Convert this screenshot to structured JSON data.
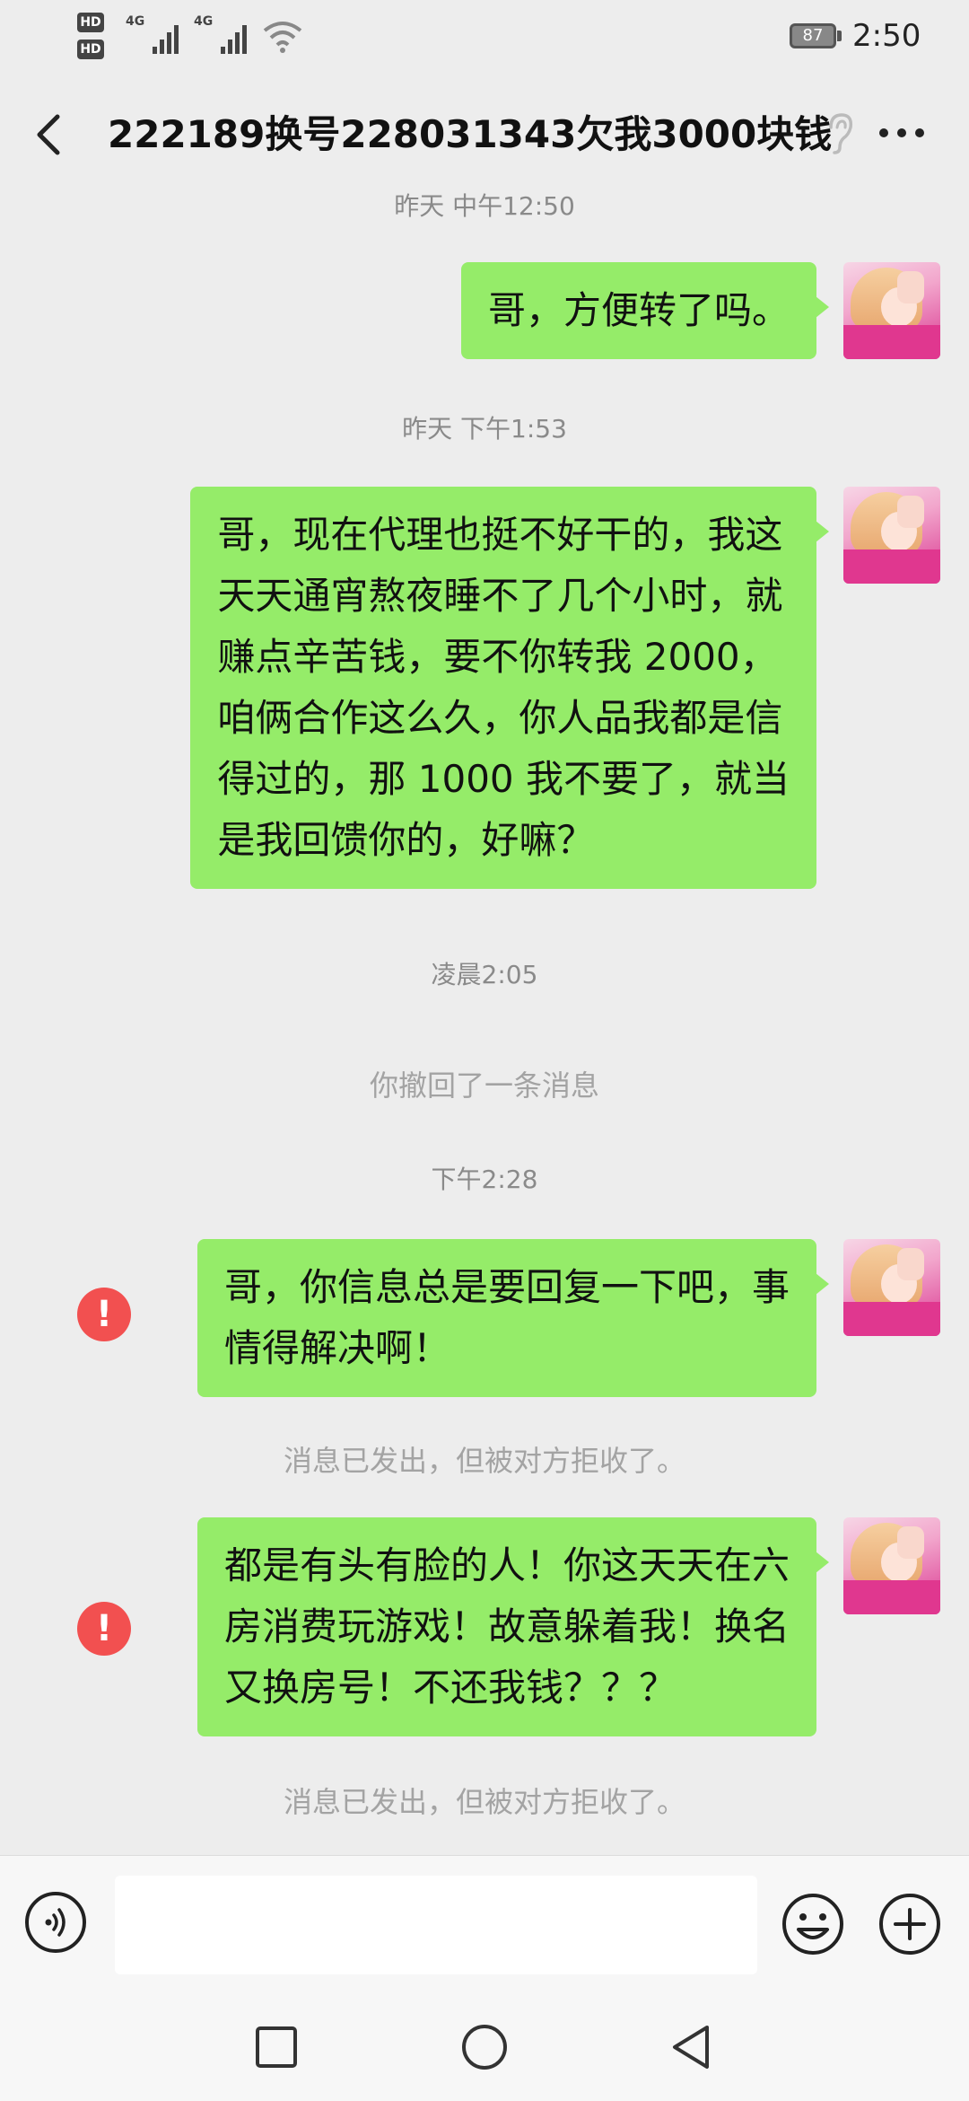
{
  "status_bar": {
    "hd1": "HD",
    "hd1_sub": "1",
    "hd2": "HD",
    "hd2_sub": "2",
    "net1": "4G",
    "net2": "4G",
    "battery": "87",
    "time": "2:50"
  },
  "header": {
    "title": "222189换号228031343欠我3000块钱",
    "back_icon": "chevron-left-icon",
    "ear_icon": "ear-icon",
    "more_icon": "more-dots-icon"
  },
  "chat": {
    "time1": "昨天 中午12:50",
    "msg1": "哥，方便转了吗。",
    "time2": "昨天 下午1:53",
    "msg2": "哥，现在代理也挺不好干的，我这\n天天通宵熬夜睡不了几个小时，就\n赚点辛苦钱，要不你转我 2000，\n咱俩合作这么久，你人品我都是信\n得过的，那 1000 我不要了，就当\n是我回馈你的，好嘛？",
    "time3": "凌晨2:05",
    "recalled": "你撤回了一条消息",
    "time4": "下午2:28",
    "msg3": "哥，你信息总是要回复一下吧，事\n情得解决啊！",
    "rejected1": "消息已发出，但被对方拒收了。",
    "msg4": "都是有头有脸的人！你这天天在六\n房消费玩游戏！故意躲着我！换名\n又换房号！不还我钱？？？",
    "rejected2": "消息已发出，但被对方拒收了。",
    "warn_symbol": "!"
  },
  "input_bar": {
    "placeholder": "",
    "voice_icon": "voice-icon",
    "emoji_icon": "emoji-icon",
    "plus_icon": "plus-icon"
  },
  "nav_bar": {
    "recent_icon": "square-icon",
    "home_icon": "circle-icon",
    "back_icon": "triangle-back-icon"
  },
  "colors": {
    "bubble": "#95ec69",
    "background": "#ededed",
    "warning": "#f25050"
  }
}
